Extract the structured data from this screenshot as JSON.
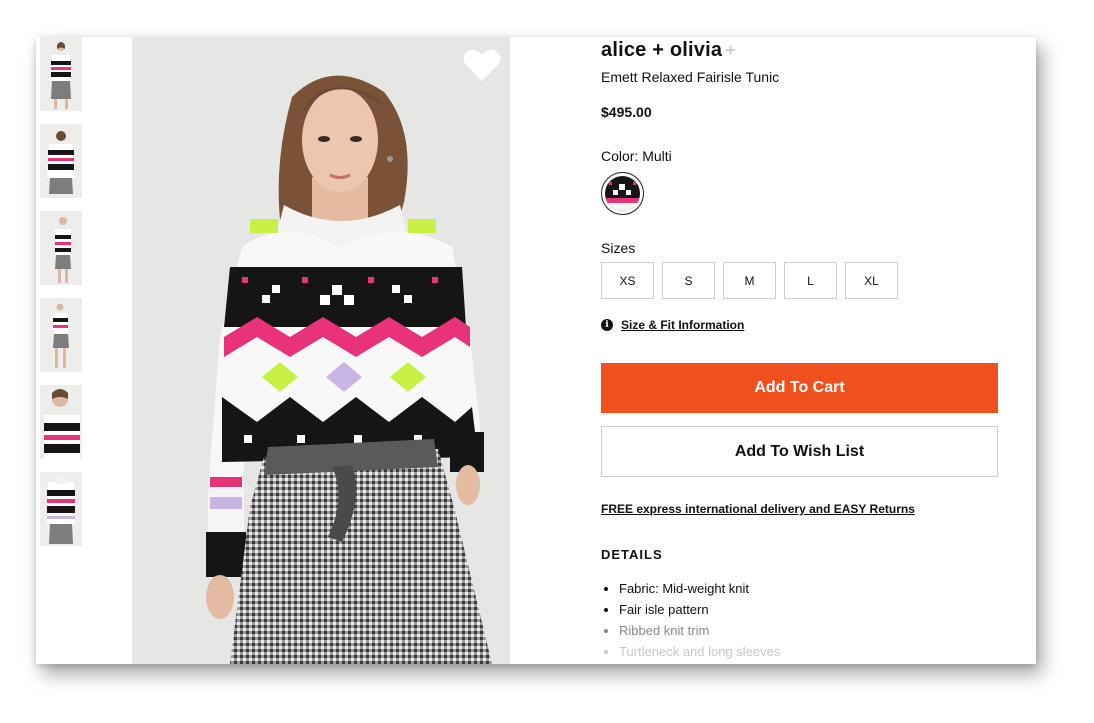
{
  "product": {
    "brand": "alice + olivia",
    "brand_plus": "+",
    "name": "Emett Relaxed Fairisle Tunic",
    "price": "$495.00",
    "color_label": "Color: Multi",
    "sizes_label": "Sizes",
    "sizes": [
      "XS",
      "S",
      "M",
      "L",
      "XL"
    ],
    "size_fit_link": "Size & Fit Information",
    "add_to_cart": "Add To Cart",
    "add_to_wishlist": "Add To Wish List",
    "delivery_link": "FREE express international delivery and EASY Returns",
    "details_heading": "DETAILS",
    "details": [
      "Fabric: Mid-weight knit",
      "Fair isle pattern",
      "Ribbed knit trim",
      "Turtleneck and long sleeves"
    ]
  },
  "gallery": {
    "thumbnail_count": 6
  },
  "icons": {
    "favorite": "heart-icon",
    "info": "info-icon"
  },
  "colors": {
    "accent": "#f0501e",
    "pink": "#e8327a",
    "lime": "#c8f046",
    "lavender": "#c9b4e6",
    "knit_black": "#151515"
  }
}
